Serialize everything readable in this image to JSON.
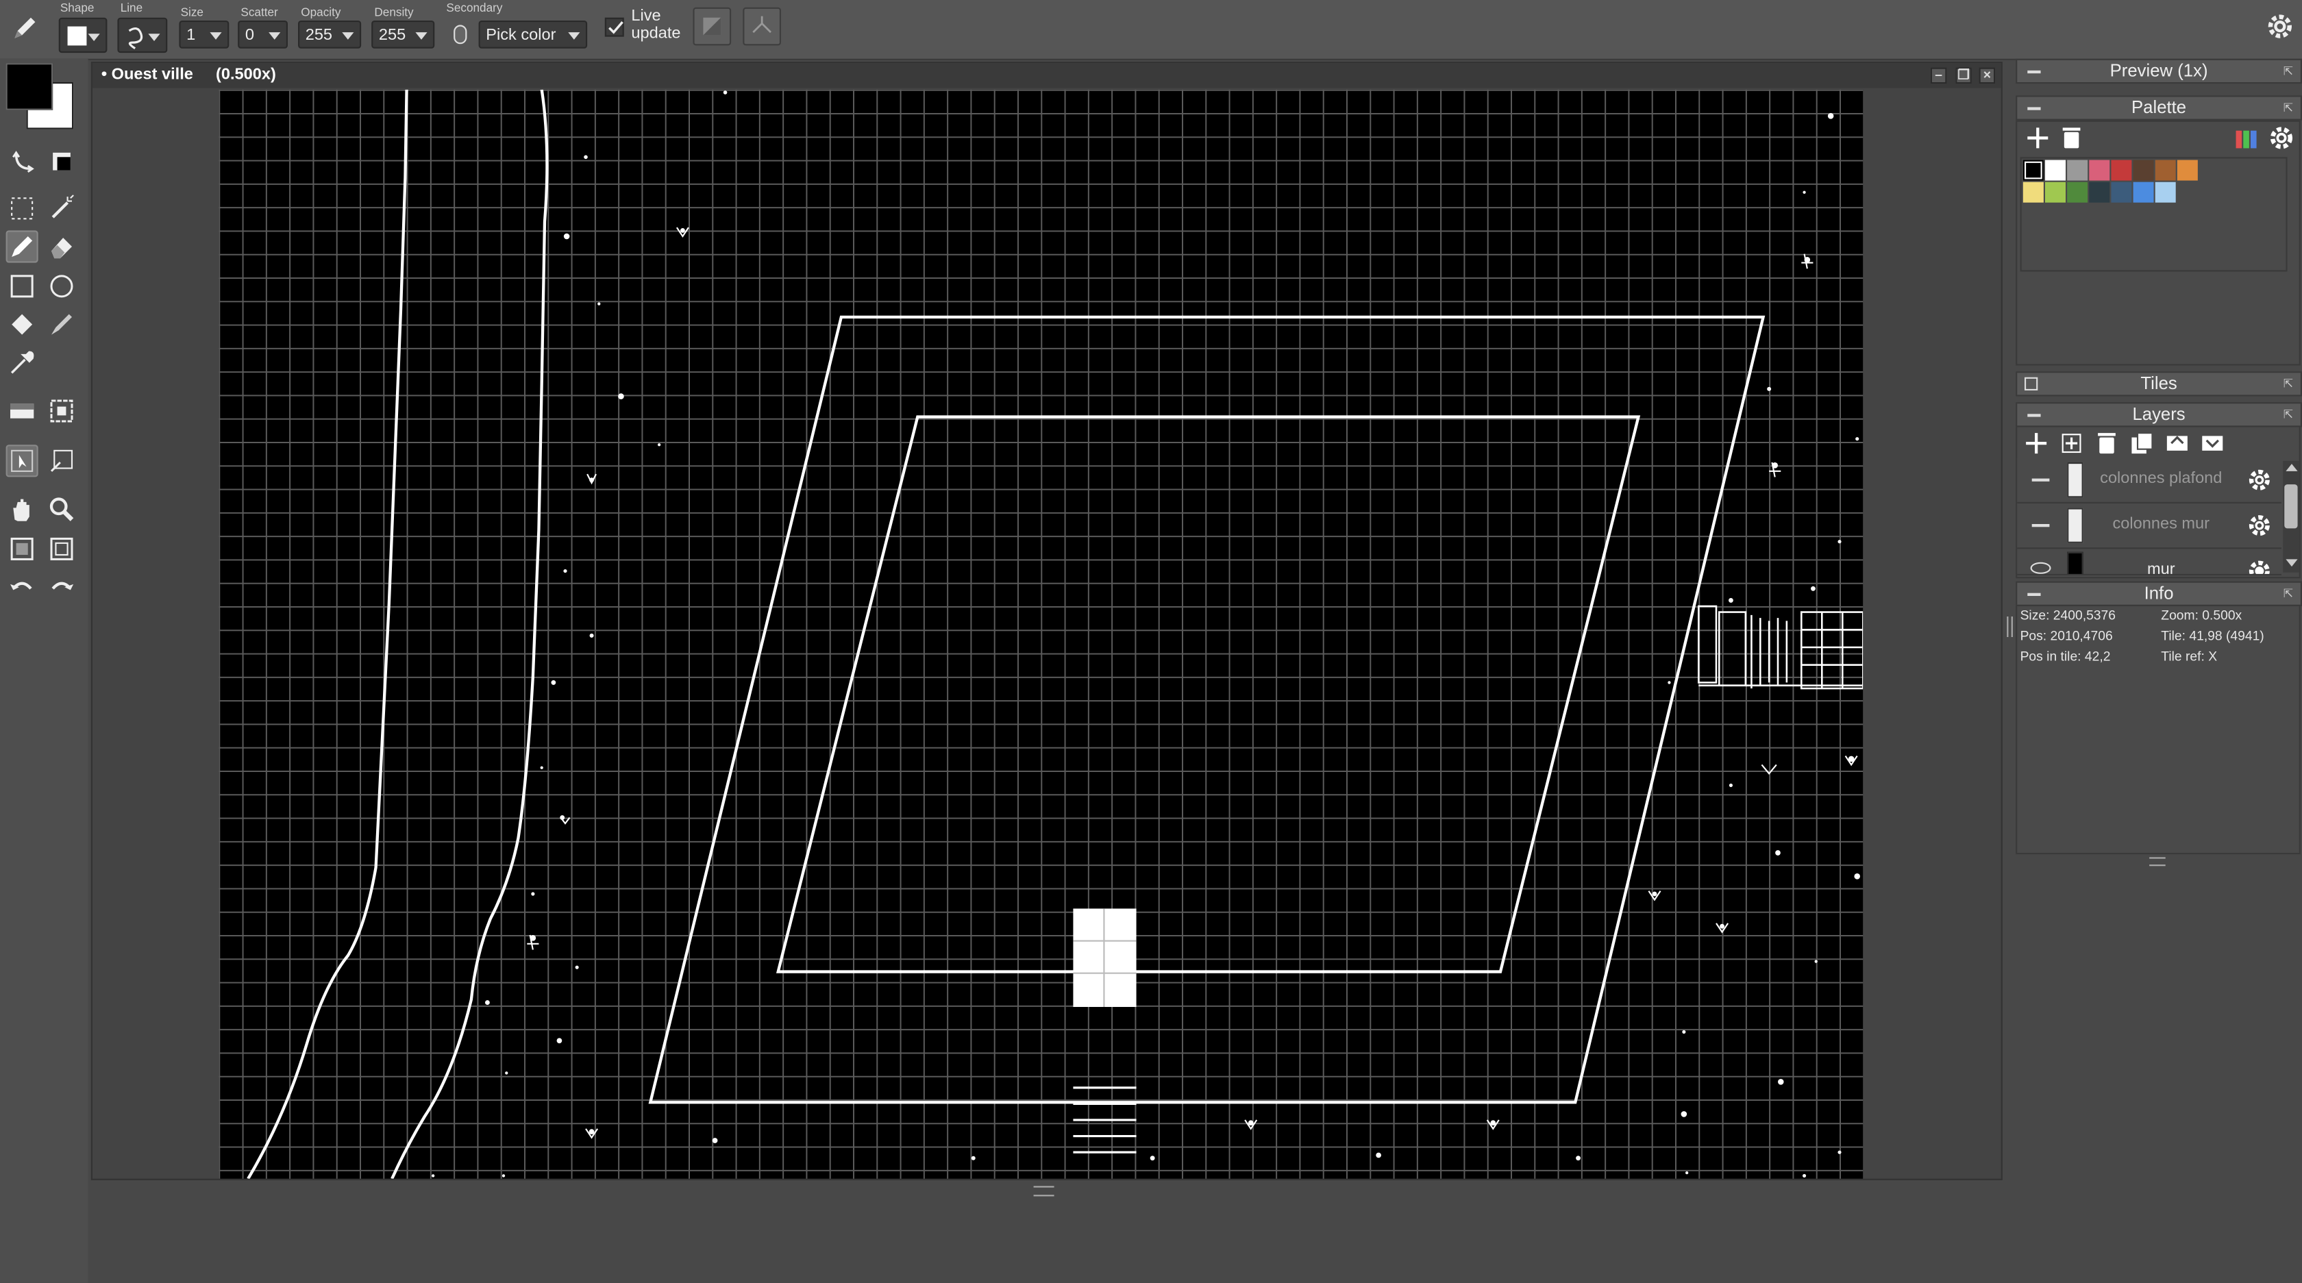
{
  "toolbar": {
    "shape_label": "Shape",
    "line_label": "Line",
    "size_label": "Size",
    "size_value": "1",
    "scatter_label": "Scatter",
    "scatter_value": "0",
    "opacity_label": "Opacity",
    "opacity_value": "255",
    "density_label": "Density",
    "density_value": "255",
    "secondary_label": "Secondary",
    "secondary_value": "Pick color",
    "live_update_line1": "Live",
    "live_update_line2": "update",
    "live_update_checked": true
  },
  "document": {
    "title": "• Ouest ville",
    "zoom": "(0.500x)"
  },
  "panels": {
    "preview_title": "Preview (1x)",
    "palette_title": "Palette",
    "tiles_title": "Tiles",
    "layers_title": "Layers",
    "info_title": "Info"
  },
  "palette": {
    "colors": [
      "#000000",
      "#ffffff",
      "#9a9a9a",
      "#d9607a",
      "#c43a3a",
      "#5a4030",
      "#a06030",
      "#e08c3c",
      "#f0dc7c",
      "#a0c850",
      "#508a3c",
      "#2c3c44",
      "#3c5c7c",
      "#4c8ce0",
      "#a8d0f0"
    ]
  },
  "layers": {
    "items": [
      {
        "name": "colonnes plafond"
      },
      {
        "name": "colonnes mur"
      },
      {
        "name": "mur"
      }
    ]
  },
  "info": {
    "size": "Size: 2400,5376",
    "zoom": "Zoom: 0.500x",
    "pos": "Pos: 2010,4706",
    "tile": "Tile: 41,98 (4941)",
    "pos_in_tile": "Pos in tile: 42,2",
    "tile_ref": "Tile ref: X"
  },
  "colors": {
    "primary": "#000000",
    "secondary": "#ffffff"
  }
}
